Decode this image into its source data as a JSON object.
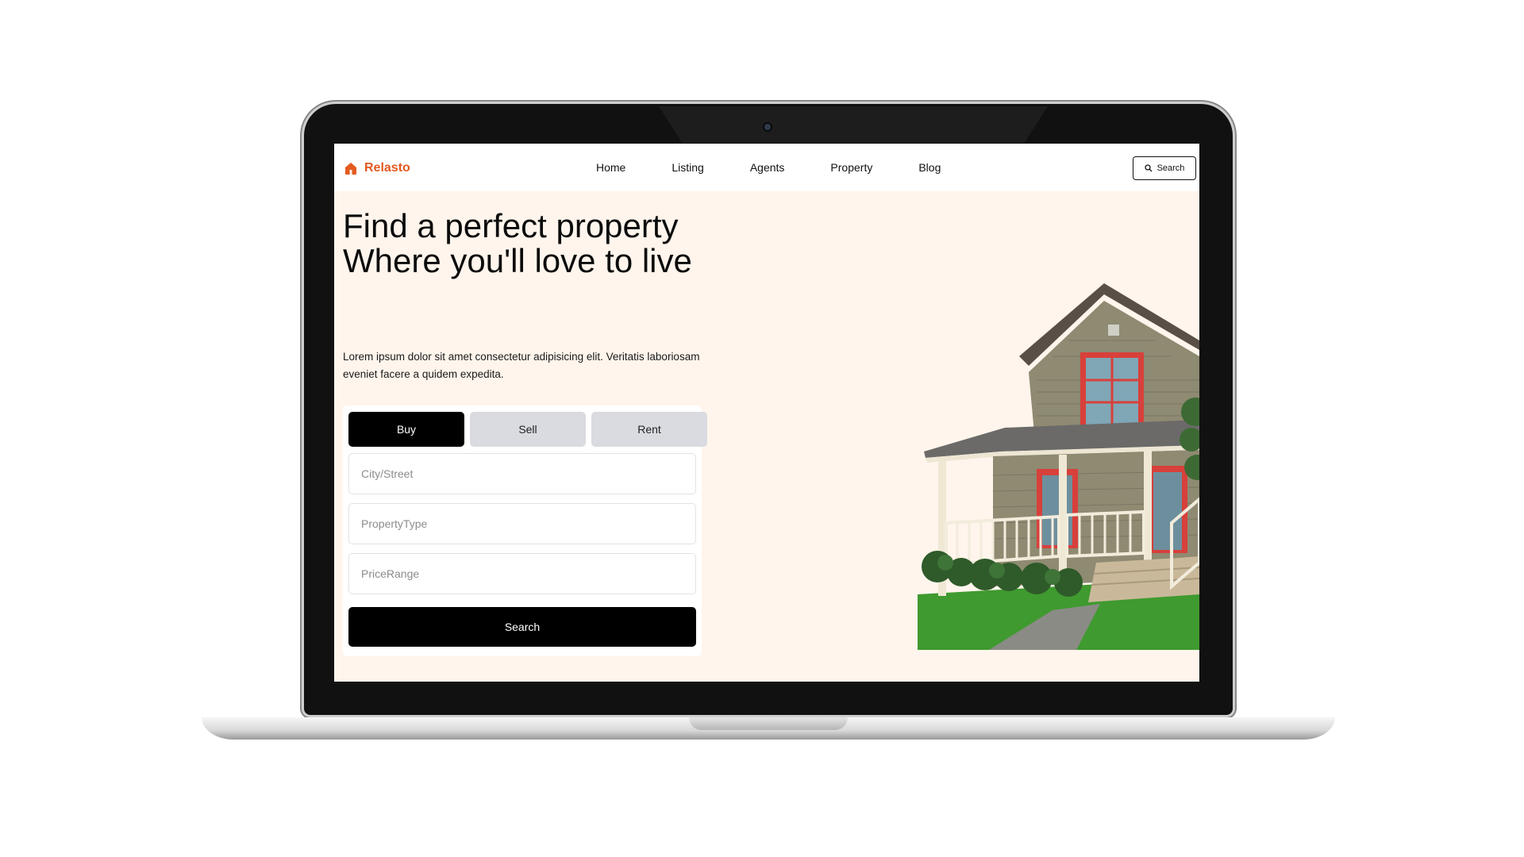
{
  "brand": {
    "name": "Relasto",
    "icon": "house-icon",
    "color": "#e35a1f"
  },
  "nav": {
    "items": [
      "Home",
      "Listing",
      "Agents",
      "Property",
      "Blog"
    ]
  },
  "header_search": {
    "label": "Search",
    "icon": "search-icon"
  },
  "hero": {
    "title_line1": "Find a perfect property",
    "title_line2": "Where you'll love to live",
    "description": "Lorem ipsum dolor sit amet consectetur adipisicing elit. Veritatis laboriosam eveniet facere a quidem expedita."
  },
  "search_form": {
    "tabs": [
      "Buy",
      "Sell",
      "Rent"
    ],
    "active_tab": "Buy",
    "city_placeholder": "City/Street",
    "type_placeholder": "PropertyType",
    "price_placeholder": "PriceRange",
    "submit_label": "Search"
  },
  "colors": {
    "hero_background": "#fff5ec",
    "primary_button": "#000000",
    "inactive_tab": "#d9dbe0"
  }
}
